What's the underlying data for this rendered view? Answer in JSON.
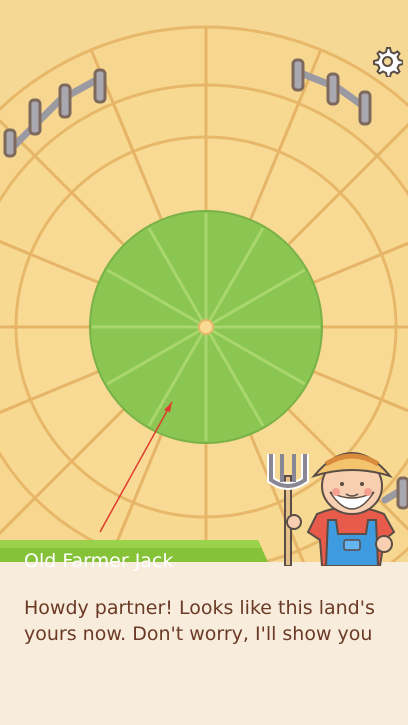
{
  "colors": {
    "sand": "#f6d895",
    "field": "#8cc652",
    "nameplate": "#86c237",
    "dialog_bg": "#f8ecdc",
    "dialog_text": "#6b3a26",
    "arrow": "#e03a2f"
  },
  "icons": {
    "settings": "gear-icon",
    "pitchfork": "pitchfork-icon"
  },
  "character": {
    "name": "Old Farmer Jack"
  },
  "dialog": {
    "text": "Howdy partner! Looks like this land's yours now. Don't worry, I'll show you"
  }
}
